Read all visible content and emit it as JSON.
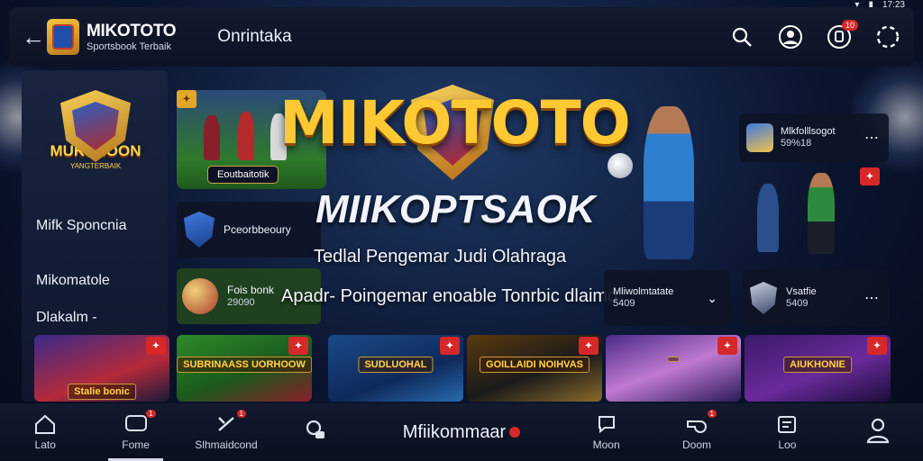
{
  "status": {
    "time": "17:23"
  },
  "header": {
    "brand_name": "MIKOTOTO",
    "brand_tagline": "Sportsbook Terbaik",
    "link": "Onrintaka",
    "notif_count": "10"
  },
  "sidebar": {
    "logo_text": "MUKSHOON",
    "logo_subtext": "YANGTERBAIK",
    "items": [
      "Mifk Sponcnia",
      "Mikomatole",
      "Dlakalm -"
    ]
  },
  "hero": {
    "title": "MIKOTOTO",
    "subtitle": "MIIKOPTSAOK",
    "tagline": "Tedlal Pengemar Judi Olahraga",
    "line": "Apadr- Poingemar enoable Tonrbic dlaimo..."
  },
  "cards": {
    "football_label": "Eoutbaitotik",
    "sportsbook_label": "Pceorbbeoury",
    "ball_title": "Fois bonk",
    "ball_value": "29090",
    "promo_right_title": "Mlkfolllsogot",
    "promo_right_sub": "59%18",
    "mid_right_1": "Mliwolmtatate",
    "mid_right_1_sub": "5409",
    "mid_right_2": "Vsatfie",
    "mid_right_2_sub": "5409"
  },
  "tiles": [
    {
      "banner": "Stalie bonic"
    },
    {
      "banner": "SUBRINAASS UORHOOW"
    },
    {
      "banner": "SUDLUOHAL"
    },
    {
      "banner": "GOILLAIDI NOIHVAS"
    },
    {
      "banner": ""
    },
    {
      "banner": "AIUKHONIE"
    }
  ],
  "bottom_nav": {
    "items": [
      {
        "label": "Lato",
        "icon": "home-icon"
      },
      {
        "label": "Fome",
        "icon": "chat-icon",
        "badge": "1"
      },
      {
        "label": "Slhmaidcond",
        "icon": "flash-icon",
        "badge": "1"
      },
      {
        "label": "",
        "icon": "gamepad-icon"
      },
      {
        "label": "Mfiikommaar",
        "icon": ""
      },
      {
        "label": "Moon",
        "icon": "message-icon"
      },
      {
        "label": "Doom",
        "icon": "whistle-icon",
        "badge": "1"
      },
      {
        "label": "Loo",
        "icon": "ticket-icon"
      },
      {
        "label": "",
        "icon": "user-icon"
      }
    ]
  },
  "colors": {
    "accent_gold": "#ffc933",
    "badge_red": "#d62828",
    "bg_navy": "#0b1530"
  }
}
